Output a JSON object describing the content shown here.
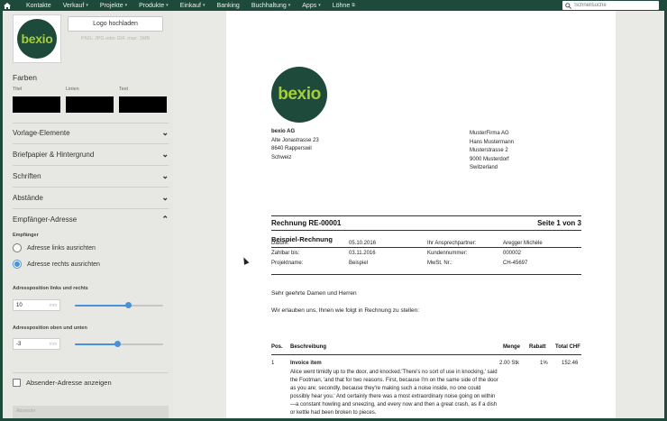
{
  "nav": {
    "items": [
      {
        "label": "Kontakte",
        "dropdown": false
      },
      {
        "label": "Verkauf",
        "dropdown": true
      },
      {
        "label": "Projekte",
        "dropdown": true
      },
      {
        "label": "Produkte",
        "dropdown": true
      },
      {
        "label": "Einkauf",
        "dropdown": true
      },
      {
        "label": "Banking",
        "dropdown": false
      },
      {
        "label": "Buchhaltung",
        "dropdown": true
      },
      {
        "label": "Apps",
        "dropdown": true
      },
      {
        "label": "Löhne",
        "dropdown": false
      }
    ],
    "search_placeholder": "Schnellsuche"
  },
  "sidebar": {
    "logo_text": "bexio",
    "upload_button": "Logo hochladen",
    "upload_hint": "PNG, JPG oder GIF, max. 1MB",
    "colors_title": "Farben",
    "color_labels": {
      "title": "Titel",
      "lines": "Linien",
      "text": "Text"
    },
    "color_values": {
      "title": "#000000",
      "lines": "#000000",
      "text": "#000000"
    },
    "accordion": [
      "Vorlage-Elemente",
      "Briefpapier & Hintergrund",
      "Schriften",
      "Abstände"
    ],
    "recipient": {
      "title": "Empfänger-Adresse",
      "sub": "Empfänger",
      "option_left": "Adresse links ausrichten",
      "option_right": "Adresse rechts ausrichten",
      "selected": "right",
      "pos_lr_label": "Adressposition links und rechts",
      "pos_lr_value": "10",
      "pos_lr_fraction": 0.6,
      "pos_tb_label": "Adressposition oben und unten",
      "pos_tb_value": "-3",
      "pos_tb_fraction": 0.48,
      "unit": "mm"
    },
    "sender_checkbox": "Absender-Adresse anzeigen",
    "disabled_field": "Ab­sender"
  },
  "doc": {
    "logo_text": "bexio",
    "sender": [
      "bexio AG",
      "Alte Jonastrasse 23",
      "8640 Rapperswil",
      "Schweiz"
    ],
    "recipient": [
      "MusterFirma AG",
      "Hans Mustermann",
      "Musterstrasse 2",
      "9000 Musterdorf",
      "Switzerland"
    ],
    "title": "Rechnung RE-00001",
    "page": "Seite 1 von 3",
    "subtitle": "Beispiel-Rechnung",
    "meta_left_labels": [
      "Datum:",
      "Zahlbar bis:",
      "Projektname:"
    ],
    "meta_left_values": [
      "05.10.2016",
      "03.11.2016",
      "Beispiel"
    ],
    "meta_right_labels": [
      "Ihr Ansprechpartner:",
      "Kundennummer:",
      "MwSt. Nr.:"
    ],
    "meta_right_values": [
      "Aregger Michèle",
      "000002",
      "CH-45697"
    ],
    "salutation": "Sehr geehrte Damen und Herren",
    "intro": "Wir erlauben uns, Ihnen wie folgt in Rechnung zu stellen:",
    "table": {
      "headers": {
        "pos": "Pos.",
        "desc": "Beschreibung",
        "qty": "Menge",
        "disc": "Rabatt",
        "total": "Total CHF"
      },
      "row": {
        "pos": "1",
        "title": "Invoice item",
        "desc": "Alice went timidly up to the door, and knocked.'There's no sort of use in knocking,' said the Footman, 'and that for two reasons. First, because I'm on the same side of the door as you are; secondly, because they're making such a noise inside, no one could possibly hear you.' And certainly there was a most extraordinary noise going on within—a constant howling and sneezing, and every now and then a great crash, as if a dish or kettle had been broken to pieces.",
        "qty": "2.00 Stk",
        "disc": "1%",
        "total": "152.46"
      }
    }
  },
  "colors": {
    "brand": "#1e4a3b",
    "logo_green": "#a6ce39",
    "accent": "#4a90d9"
  }
}
